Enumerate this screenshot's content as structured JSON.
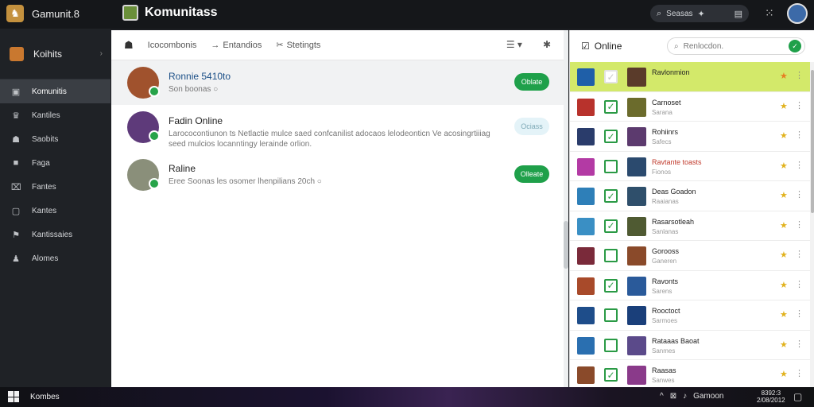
{
  "titlebar": {
    "app_title": "Gamunit.8"
  },
  "main_title": "Komunitass",
  "top_search": {
    "placeholder": "Seasas"
  },
  "sidebar": {
    "header_label": "Koihits",
    "items": [
      {
        "label": "Komunitis",
        "icon": "▣"
      },
      {
        "label": "Kantiles",
        "icon": "♛"
      },
      {
        "label": "Saobits",
        "icon": "☗"
      },
      {
        "label": "Faga",
        "icon": "■"
      },
      {
        "label": "Fantes",
        "icon": "⌧"
      },
      {
        "label": "Kantes",
        "icon": "▢"
      },
      {
        "label": "Kantissaies",
        "icon": "⚑"
      },
      {
        "label": "Alomes",
        "icon": "♟"
      }
    ]
  },
  "toolbar": {
    "tab1": "Icocombonis",
    "tab2": "Entandios",
    "tab3": "Stetingts"
  },
  "conversations": [
    {
      "name": "Ronnie 5410to",
      "message": "Son boonas",
      "button": "Oblate",
      "avatar_color": "#a0522d"
    },
    {
      "name": "Fadin Online",
      "message": "Larococontiunon ts Netlactie mulce saed confcanilist adocaos lelodeonticn Ve acosingrtiiiag seed mulcios locanntingy lerainde orlion.",
      "button": "Ociass",
      "avatar_color": "#5e3a7a"
    },
    {
      "name": "Raline",
      "message": "Eree Soonas les osomer lhenpilians 20ch",
      "button": "Olleate",
      "avatar_color": "#8a8f7a"
    }
  ],
  "right_panel": {
    "header": "Online",
    "search_placeholder": "Renlocdon."
  },
  "friends": [
    {
      "name": "Ravlonmion",
      "sub": "",
      "checked": false,
      "red": false,
      "game_color": "#1f5fa8",
      "avatar_color": "#5a3b2a"
    },
    {
      "name": "Carnoset",
      "sub": "Sarana",
      "checked": true,
      "red": false,
      "game_color": "#b8322c",
      "avatar_color": "#6b6b2c"
    },
    {
      "name": "Rohiinrs",
      "sub": "Safecs",
      "checked": true,
      "red": false,
      "game_color": "#2a3c6b",
      "avatar_color": "#5c3a6e"
    },
    {
      "name": "Ravtante toasts",
      "sub": "Fionos",
      "checked": false,
      "red": true,
      "game_color": "#b33aa4",
      "avatar_color": "#2b4a6e"
    },
    {
      "name": "Deas Goadon",
      "sub": "Raaianas",
      "checked": true,
      "red": false,
      "game_color": "#2e7fb8",
      "avatar_color": "#2f4f6b"
    },
    {
      "name": "Rasarsotleah",
      "sub": "Sanlanas",
      "checked": true,
      "red": false,
      "game_color": "#3a8fc4",
      "avatar_color": "#4f5a32"
    },
    {
      "name": "Gorooss",
      "sub": "Ganeren",
      "checked": false,
      "red": false,
      "game_color": "#7a2a3a",
      "avatar_color": "#8a4a2a"
    },
    {
      "name": "Ravonts",
      "sub": "Sarens",
      "checked": true,
      "red": false,
      "game_color": "#a84a2a",
      "avatar_color": "#2a5a9a"
    },
    {
      "name": "Rooctoct",
      "sub": "Sarmoes",
      "checked": false,
      "red": false,
      "game_color": "#1e4d8a",
      "avatar_color": "#1a3f7a"
    },
    {
      "name": "Rataaas Baoat",
      "sub": "Sanmes",
      "checked": false,
      "red": false,
      "game_color": "#2a6fb0",
      "avatar_color": "#5b4a8a"
    },
    {
      "name": "Raasas",
      "sub": "Sanwes",
      "checked": true,
      "red": false,
      "game_color": "#8a4a2a",
      "avatar_color": "#8a3a8a"
    }
  ],
  "taskbar": {
    "app_label": "Kombes",
    "tray_text": "Gamoon",
    "clock_time": "8392:3",
    "clock_date": "2/08/2012"
  }
}
